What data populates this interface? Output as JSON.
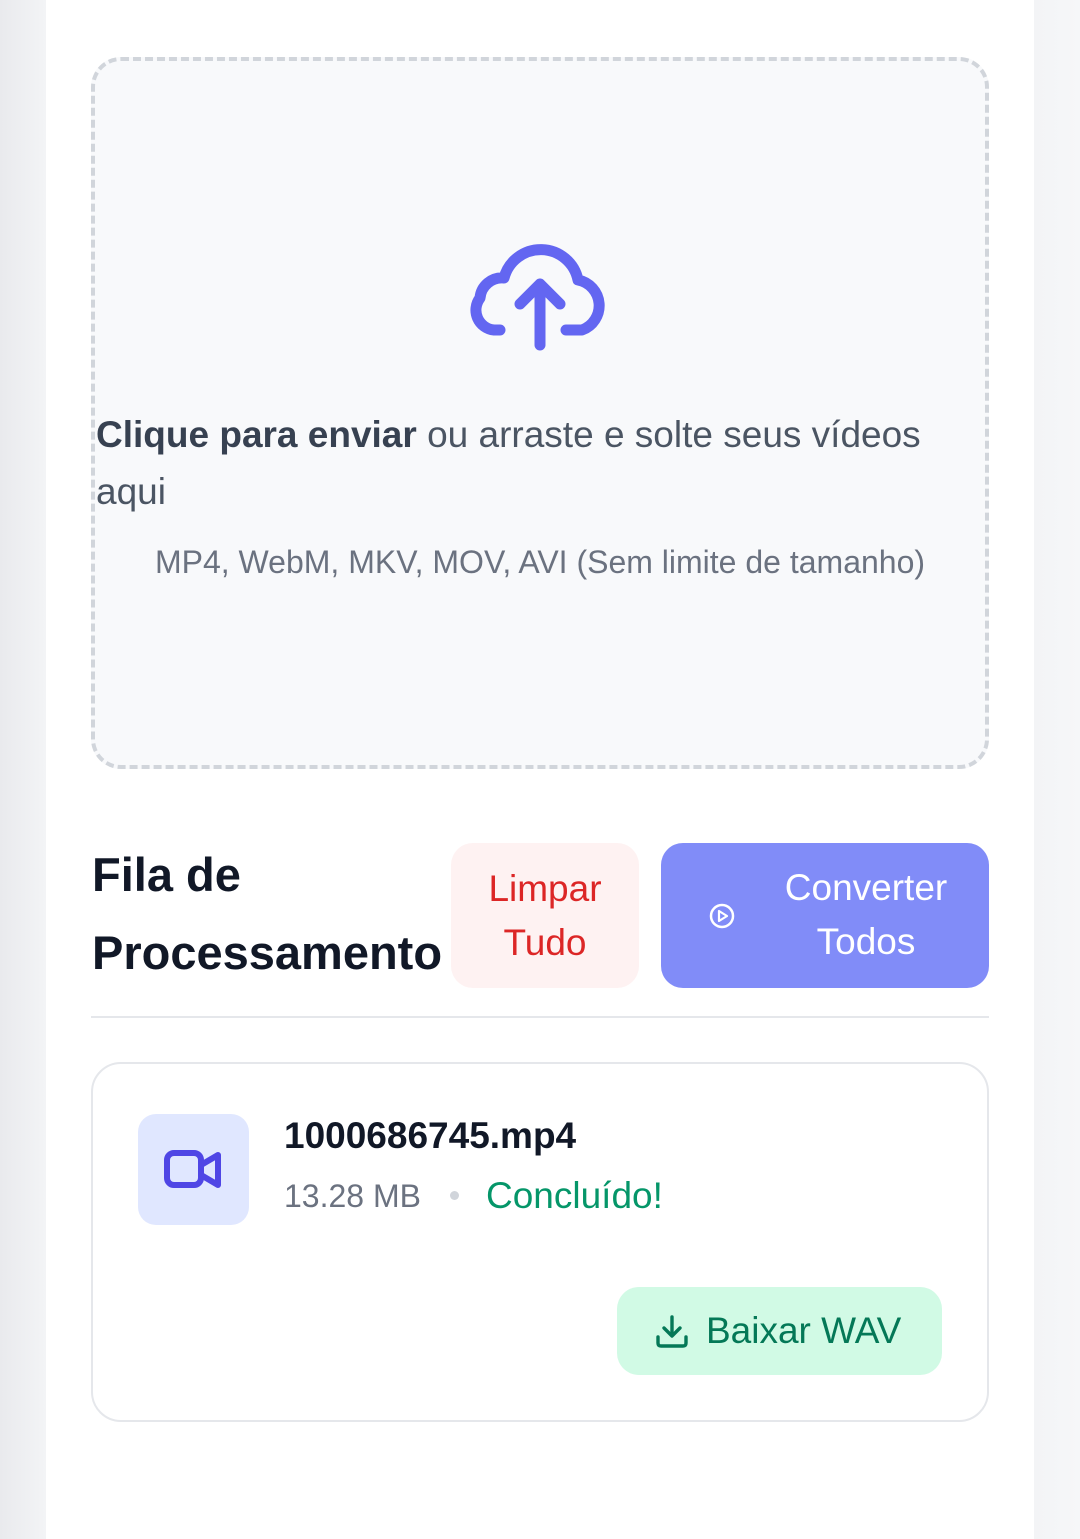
{
  "upload": {
    "icon": "cloud-upload-icon",
    "text_strong": "Clique para enviar",
    "text_rest": " ou arraste e solte seus vídeos aqui",
    "hint": "MP4, WebM, MKV, MOV, AVI (Sem limite de tamanho)"
  },
  "queue": {
    "title": "Fila de Processamento",
    "clear_label": "Limpar Tudo",
    "convert_label": "Converter Todos",
    "convert_icon": "play-circle-icon"
  },
  "files": [
    {
      "name": "1000686745.mp4",
      "size": "13.28 MB",
      "status": "Concluído!",
      "download_label": "Baixar WAV",
      "icon": "video-camera-icon"
    }
  ],
  "colors": {
    "accent": "#6366f1",
    "convert_bg": "#818cf8",
    "clear_text": "#dc2626",
    "clear_bg": "#fef2f2",
    "success": "#059669",
    "download_bg": "#d1fae5"
  }
}
